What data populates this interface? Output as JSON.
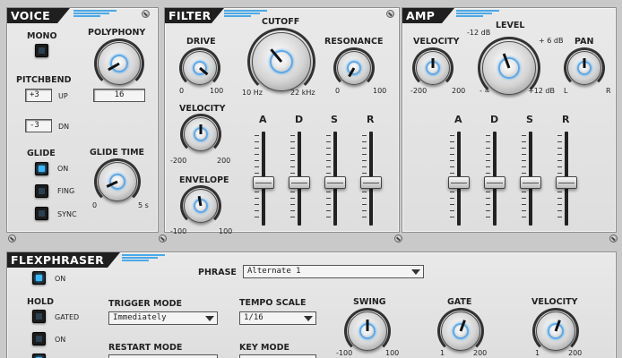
{
  "voice": {
    "title": "VOICE",
    "mono": "MONO",
    "polyphony": "POLYPHONY",
    "polyphony_value": "16",
    "pitchbend": "PITCHBEND",
    "pb_up_value": "+3",
    "pb_up_label": "UP",
    "pb_dn_value": "-3",
    "pb_dn_label": "DN",
    "glide": "GLIDE",
    "glide_on": "ON",
    "glide_fing": "FING",
    "glide_sync": "SYNC",
    "glide_time": "GLIDE TIME",
    "glide_time_min": "0",
    "glide_time_max": "5 s"
  },
  "filter": {
    "title": "FILTER",
    "cutoff": "CUTOFF",
    "cutoff_min": "10 Hz",
    "cutoff_max": "22 kHz",
    "drive": "DRIVE",
    "drive_min": "0",
    "drive_max": "100",
    "resonance": "RESONANCE",
    "res_min": "0",
    "res_max": "100",
    "velocity": "VELOCITY",
    "vel_min": "-200",
    "vel_max": "200",
    "envelope": "ENVELOPE",
    "env_min": "-100",
    "env_max": "100",
    "adsr": [
      "A",
      "D",
      "S",
      "R"
    ]
  },
  "amp": {
    "title": "AMP",
    "velocity": "VELOCITY",
    "vel_min": "-200",
    "vel_max": "200",
    "level": "LEVEL",
    "level_top_left": "-12 dB",
    "level_top_right": "+ 6 dB",
    "level_min": "- ∞",
    "level_max": "+12 dB",
    "pan": "PAN",
    "pan_min": "L",
    "pan_max": "R",
    "adsr": [
      "A",
      "D",
      "S",
      "R"
    ]
  },
  "flexphraser": {
    "title": "FLEXPHRASER",
    "on": "ON",
    "phrase_label": "PHRASE",
    "phrase_value": "Alternate 1",
    "hold": "HOLD",
    "hold_gated": "GATED",
    "hold_on": "ON",
    "trigger_mode": "TRIGGER MODE",
    "trigger_value": "Immediately",
    "tempo_scale": "TEMPO SCALE",
    "tempo_value": "1/16",
    "restart_mode": "RESTART MODE",
    "key_mode": "KEY MODE",
    "swing": "SWING",
    "swing_min": "-100",
    "swing_max": "100",
    "gate": "GATE",
    "gate_min": "1",
    "gate_max": "200",
    "velocity": "VELOCITY",
    "vel_min": "1",
    "vel_max": "200"
  },
  "colors": {
    "accent": "#4aa8e6",
    "led_on": "#3bb6ff",
    "title_bg": "#1f1f1f"
  }
}
